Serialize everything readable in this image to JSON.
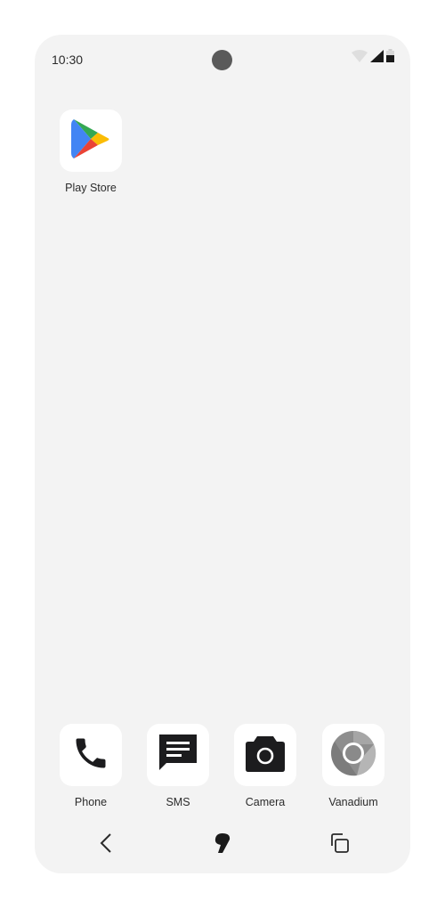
{
  "status_bar": {
    "time": "10:30",
    "icons": [
      "wifi-icon",
      "cellular-signal-icon",
      "battery-icon"
    ]
  },
  "home": {
    "apps": [
      {
        "label": "Play Store",
        "icon": "play-store-icon"
      }
    ]
  },
  "dock": {
    "apps": [
      {
        "label": "Phone",
        "icon": "phone-icon"
      },
      {
        "label": "SMS",
        "icon": "sms-icon"
      },
      {
        "label": "Camera",
        "icon": "camera-icon"
      },
      {
        "label": "Vanadium",
        "icon": "vanadium-browser-icon"
      }
    ]
  },
  "nav_bar": {
    "buttons": [
      "back",
      "home",
      "recents"
    ]
  },
  "colors": {
    "screen_bg": "#f3f3f3",
    "tile_bg": "#ffffff",
    "icon_dark": "#1c1c1e",
    "play_green": "#34a853",
    "play_blue": "#4285f4",
    "play_yellow": "#fbbc04",
    "play_red": "#ea4335"
  }
}
